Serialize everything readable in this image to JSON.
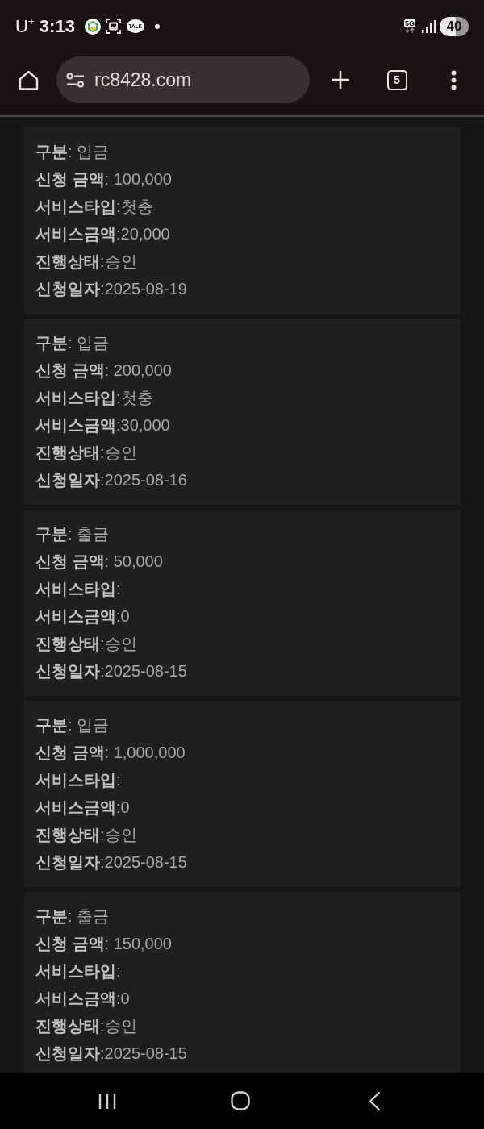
{
  "status_bar": {
    "carrier": "U$^{+}$",
    "time": "3:13",
    "chat_badge": "TALK",
    "network": "5G",
    "battery": "40"
  },
  "browser_toolbar": {
    "url": "rc8428.com",
    "tab_count": "5"
  },
  "records": [
    {
      "lines": [
        "**구분**: 입금",
        "**신청 금액**: 100,000",
        "**서비스타입**:첫충",
        "**서비스금액**:20,000",
        "**진행상태**:승인",
        "**신청일자**:2025-08-19"
      ]
    },
    {
      "lines": [
        "**구분**: 입금",
        "**신청 금액**: 200,000",
        "**서비스타입**:첫충",
        "**서비스금액**:30,000",
        "**진행상태**:승인",
        "**신청일자**:2025-08-16"
      ]
    },
    {
      "lines": [
        "**구분**: 출금",
        "**신청 금액**: 50,000",
        "**서비스타입**:",
        "**서비스금액**:0",
        "**진행상태**:승인",
        "**신청일자**:2025-08-15"
      ]
    },
    {
      "lines": [
        "**구분**: 입금",
        "**신청 금액**: 1,000,000",
        "**서비스타입**:",
        "**서비스금액**:0",
        "**진행상태**:승인",
        "**신청일자**:2025-08-15"
      ]
    },
    {
      "lines": [
        "**구분**: 출금",
        "**신청 금액**: 150,000",
        "**서비스타입**:",
        "**서비스금액**:0",
        "**진행상태**:승인",
        "**신청일자**:2025-08-15"
      ]
    }
  ]
}
